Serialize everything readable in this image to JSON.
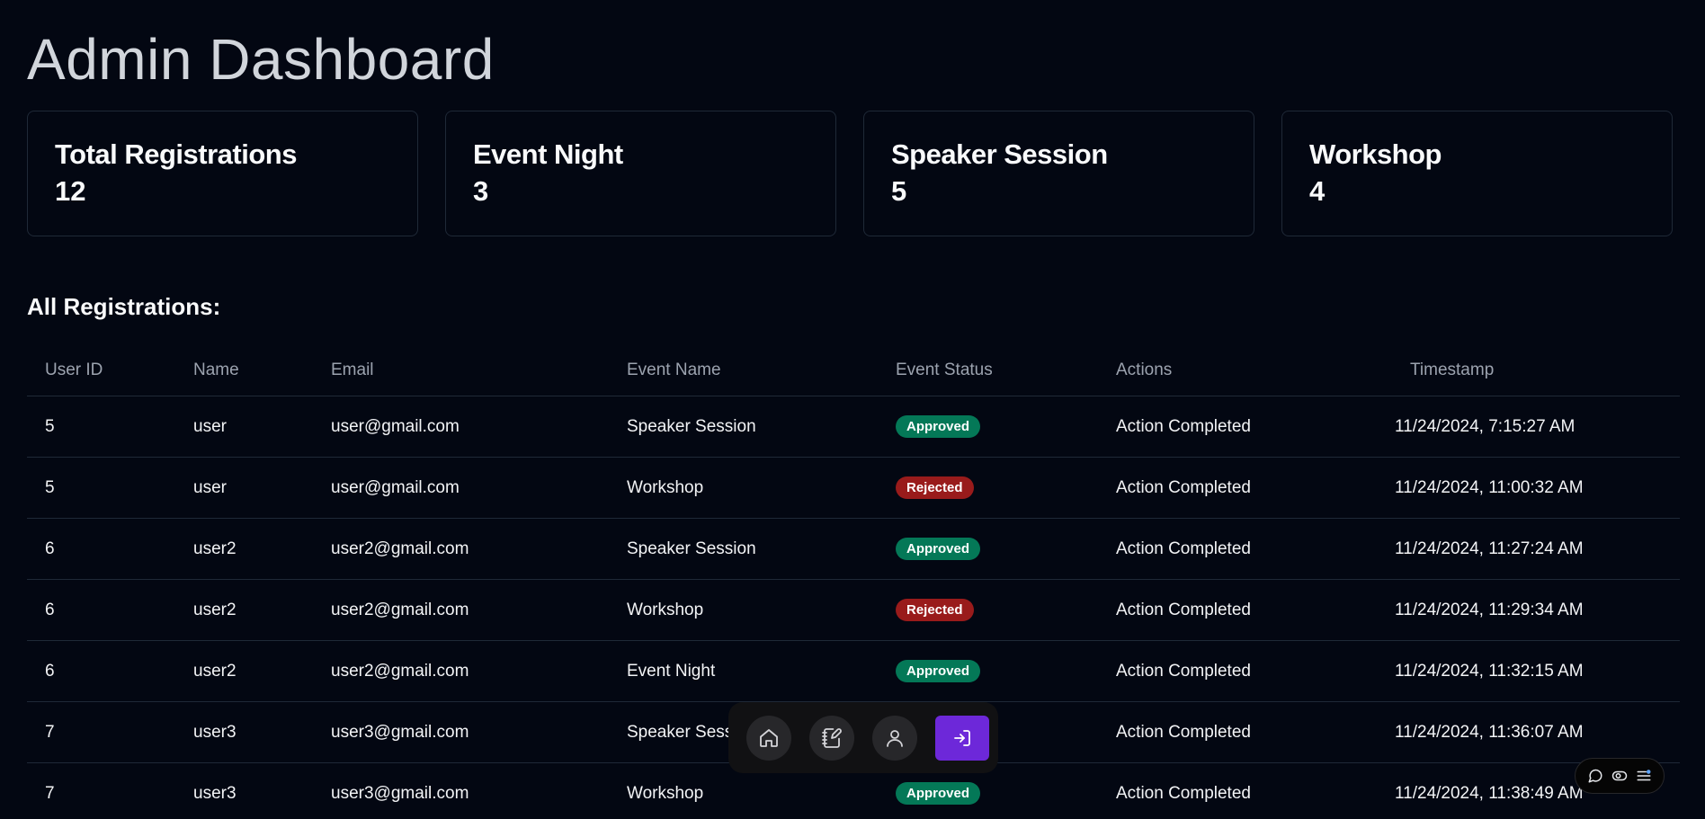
{
  "header": {
    "title": "Admin Dashboard"
  },
  "stats": [
    {
      "label": "Total Registrations",
      "value": "12"
    },
    {
      "label": "Event Night",
      "value": "3"
    },
    {
      "label": "Speaker Session",
      "value": "5"
    },
    {
      "label": "Workshop",
      "value": "4"
    }
  ],
  "section_title": "All Registrations:",
  "table": {
    "headers": {
      "user_id": "User ID",
      "name": "Name",
      "email": "Email",
      "event_name": "Event Name",
      "event_status": "Event Status",
      "actions": "Actions",
      "timestamp": "Timestamp"
    },
    "rows": [
      {
        "user_id": "5",
        "name": "user",
        "email": "user@gmail.com",
        "event_name": "Speaker Session",
        "status": "Approved",
        "actions": "Action Completed",
        "timestamp": "11/24/2024, 7:15:27 AM"
      },
      {
        "user_id": "5",
        "name": "user",
        "email": "user@gmail.com",
        "event_name": "Workshop",
        "status": "Rejected",
        "actions": "Action Completed",
        "timestamp": "11/24/2024, 11:00:32 AM"
      },
      {
        "user_id": "6",
        "name": "user2",
        "email": "user2@gmail.com",
        "event_name": "Speaker Session",
        "status": "Approved",
        "actions": "Action Completed",
        "timestamp": "11/24/2024, 11:27:24 AM"
      },
      {
        "user_id": "6",
        "name": "user2",
        "email": "user2@gmail.com",
        "event_name": "Workshop",
        "status": "Rejected",
        "actions": "Action Completed",
        "timestamp": "11/24/2024, 11:29:34 AM"
      },
      {
        "user_id": "6",
        "name": "user2",
        "email": "user2@gmail.com",
        "event_name": "Event Night",
        "status": "Approved",
        "actions": "Action Completed",
        "timestamp": "11/24/2024, 11:32:15 AM"
      },
      {
        "user_id": "7",
        "name": "user3",
        "email": "user3@gmail.com",
        "event_name": "Speaker Session",
        "status": "",
        "actions": "Action Completed",
        "timestamp": "11/24/2024, 11:36:07 AM"
      },
      {
        "user_id": "7",
        "name": "user3",
        "email": "user3@gmail.com",
        "event_name": "Workshop",
        "status": "Approved",
        "actions": "Action Completed",
        "timestamp": "11/24/2024, 11:38:49 AM"
      }
    ]
  },
  "dock": {
    "items": [
      {
        "icon": "home-icon"
      },
      {
        "icon": "notebook-pen-icon"
      },
      {
        "icon": "user-icon"
      },
      {
        "icon": "logout-icon"
      }
    ]
  },
  "widget": {
    "icons": [
      "chat-bubble-icon",
      "eye-toggle-icon",
      "menu-settings-icon"
    ]
  },
  "colors": {
    "background": "#030712",
    "approved": "#047857",
    "rejected": "#991b1b",
    "accent": "#6d28d9"
  }
}
